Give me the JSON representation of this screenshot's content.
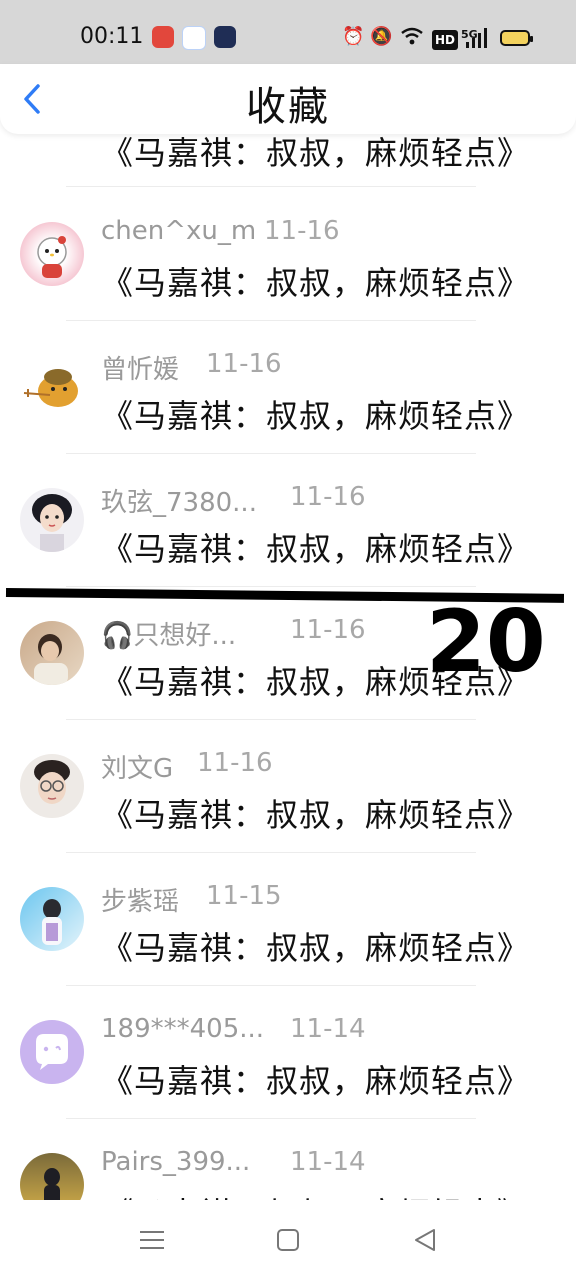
{
  "status_bar": {
    "time": "00:11",
    "network_label": "HD",
    "signal_label": "5G"
  },
  "header": {
    "title": "收藏"
  },
  "items": [
    {
      "name": "",
      "date": "",
      "content": "《马嘉祺：叔叔，麻烦轻点》"
    },
    {
      "name": "chen^xu_m",
      "date": "11-16",
      "content": "《马嘉祺：叔叔，麻烦轻点》"
    },
    {
      "name": "曾忻媛",
      "date": "11-16",
      "content": "《马嘉祺：叔叔，麻烦轻点》"
    },
    {
      "name": "玖弦_7380...",
      "date": "11-16",
      "content": "《马嘉祺：叔叔，麻烦轻点》"
    },
    {
      "name": "🎧只想好...",
      "date": "11-16",
      "content": "《马嘉祺：叔叔，麻烦轻点》"
    },
    {
      "name": "刘文G",
      "date": "11-16",
      "content": "《马嘉祺：叔叔，麻烦轻点》"
    },
    {
      "name": "步紫瑶",
      "date": "11-15",
      "content": "《马嘉祺：叔叔，麻烦轻点》"
    },
    {
      "name": "189***405...",
      "date": "11-14",
      "content": "《马嘉祺：叔叔，麻烦轻点》"
    },
    {
      "name": "Pairs_399...",
      "date": "11-14",
      "content": "《马嘉祺：叔叔，麻烦轻点》"
    }
  ],
  "overlay": {
    "number": "20"
  },
  "colors": {
    "accent": "#2f7cf6",
    "status_bg": "#d7d7d7"
  }
}
